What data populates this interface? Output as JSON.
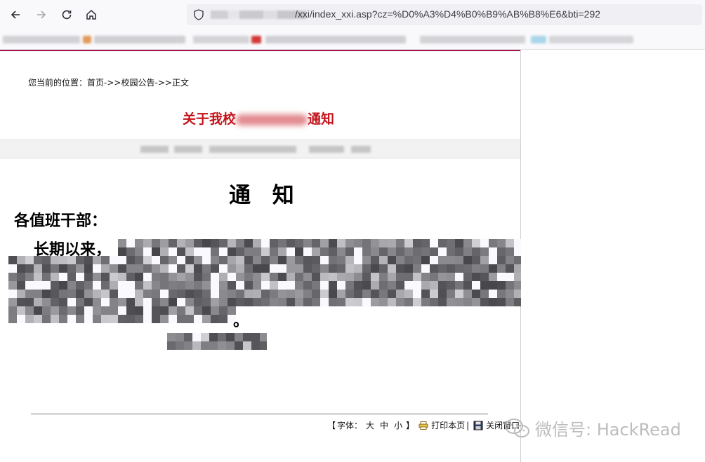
{
  "browser": {
    "url_text": "/xxi/index_xxi.asp?cz=%D0%A3%D4%B0%B9%AB%B8%E6&bti=292",
    "nav_icons": [
      "back-icon",
      "forward-icon",
      "reload-icon",
      "home-icon",
      "shield-icon"
    ]
  },
  "breadcrumb": {
    "prefix": "您当前的位置：",
    "home": "首页",
    "sep1": "->>",
    "section": "校园公告",
    "sep2": "->>",
    "current": "正文"
  },
  "article": {
    "title_start": "关于我校",
    "title_end": "通知",
    "title_color": "#c4141b",
    "doc_heading": "通 知",
    "salutation": "各值班干部：",
    "paragraph_start": "长期以来，",
    "paragraph_end": "。"
  },
  "footer": {
    "bracket_open": "【",
    "font_label": "字体：",
    "size_large": "大",
    "size_medium": "中",
    "size_small": "小",
    "bracket_close": "】",
    "print_label": "打印本页",
    "divider": "|",
    "close_label": "关闭窗口"
  },
  "watermark": {
    "text": "微信号: HackRead"
  }
}
